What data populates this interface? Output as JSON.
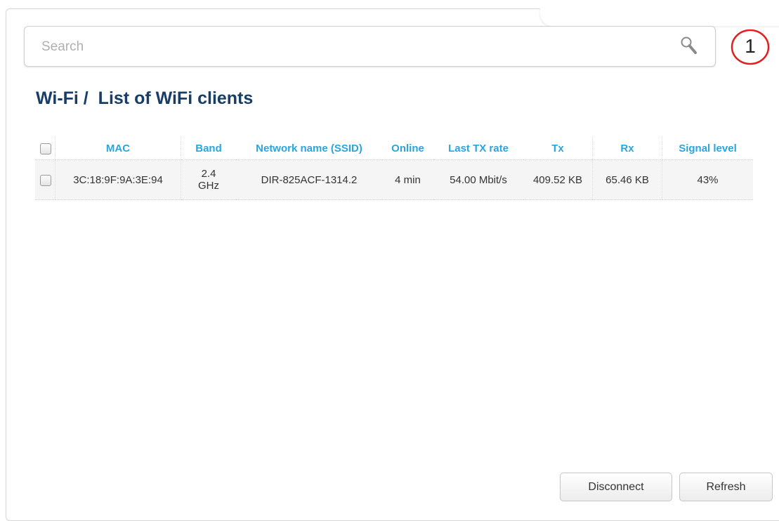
{
  "search": {
    "placeholder": "Search"
  },
  "annotation": {
    "number": "1"
  },
  "breadcrumb": {
    "section": "Wi-Fi /",
    "page": "List of WiFi clients"
  },
  "table": {
    "columns": [
      "MAC",
      "Band",
      "Network name (SSID)",
      "Online",
      "Last TX rate",
      "Tx",
      "Rx",
      "Signal level"
    ],
    "rows": [
      {
        "mac": "3C:18:9F:9A:3E:94",
        "band_value": "2.4",
        "band_unit": "GHz",
        "ssid": "DIR-825ACF-1314.2",
        "online": "4 min",
        "last_tx_rate": "54.00 Mbit/s",
        "tx": "409.52 KB",
        "rx": "65.46 KB",
        "signal": "43%"
      }
    ]
  },
  "buttons": {
    "disconnect": "Disconnect",
    "refresh": "Refresh"
  },
  "colors": {
    "title": "#183d66",
    "header": "#27a6e2",
    "annotation": "#e41e1e"
  }
}
